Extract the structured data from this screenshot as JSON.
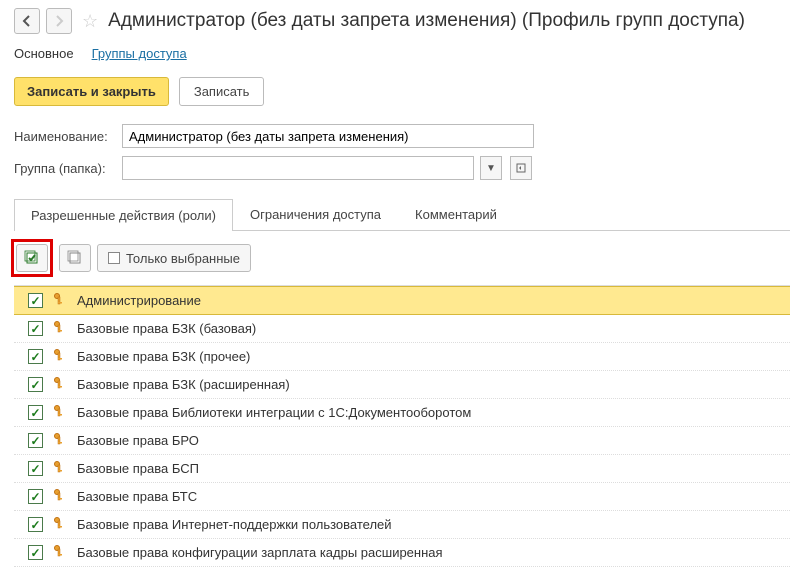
{
  "header": {
    "title": "Администратор (без даты запрета изменения) (Профиль групп доступа)"
  },
  "subnav": {
    "main": "Основное",
    "groups": "Группы доступа"
  },
  "toolbar": {
    "save_and_close": "Записать и закрыть",
    "save": "Записать"
  },
  "form": {
    "name_label": "Наименование:",
    "name_value": "Администратор (без даты запрета изменения)",
    "group_label": "Группа (папка):",
    "group_value": ""
  },
  "tabs": {
    "roles": "Разрешенные действия (роли)",
    "restrictions": "Ограничения доступа",
    "comment": "Комментарий"
  },
  "roles_toolbar": {
    "only_selected": "Только выбранные"
  },
  "roles": [
    {
      "label": "Администрирование",
      "selected": true
    },
    {
      "label": "Базовые права БЗК (базовая)",
      "selected": false
    },
    {
      "label": "Базовые права БЗК (прочее)",
      "selected": false
    },
    {
      "label": "Базовые права БЗК (расширенная)",
      "selected": false
    },
    {
      "label": "Базовые права Библиотеки интеграции с 1С:Документооборотом",
      "selected": false
    },
    {
      "label": "Базовые права БРО",
      "selected": false
    },
    {
      "label": "Базовые права БСП",
      "selected": false
    },
    {
      "label": "Базовые права БТС",
      "selected": false
    },
    {
      "label": "Базовые права Интернет-поддержки пользователей",
      "selected": false
    },
    {
      "label": "Базовые права конфигурации зарплата кадры расширенная",
      "selected": false
    }
  ]
}
